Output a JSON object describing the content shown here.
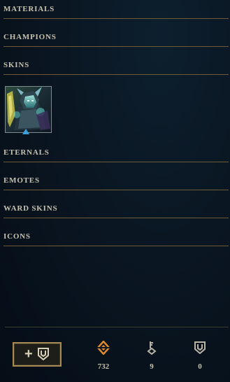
{
  "categories": [
    {
      "key": "materials",
      "label": "MATERIALS"
    },
    {
      "key": "champions",
      "label": "CHAMPIONS"
    },
    {
      "key": "skins",
      "label": "SKINS"
    },
    {
      "key": "eternals",
      "label": "ETERNALS"
    },
    {
      "key": "emotes",
      "label": "EMOTES"
    },
    {
      "key": "ward_skins",
      "label": "WARD SKINS"
    },
    {
      "key": "icons",
      "label": "ICONS"
    }
  ],
  "skins": {
    "items": [
      {
        "icon": "champion-skin-portrait"
      }
    ]
  },
  "footer": {
    "craft_button": {
      "plus": "+",
      "icon": "chest-icon"
    },
    "currencies": [
      {
        "icon": "orange-essence-icon",
        "value": "732",
        "color": "#e08a2c"
      },
      {
        "icon": "key-fragment-icon",
        "value": "9",
        "color": "#b8b4a6"
      },
      {
        "icon": "chest-icon",
        "value": "0",
        "color": "#b8b4a6"
      }
    ]
  },
  "colors": {
    "divider": "#6e5a36",
    "label": "#c8c2b0",
    "accent_gold": "#a88b52",
    "marker_blue": "#3aa0d8"
  }
}
